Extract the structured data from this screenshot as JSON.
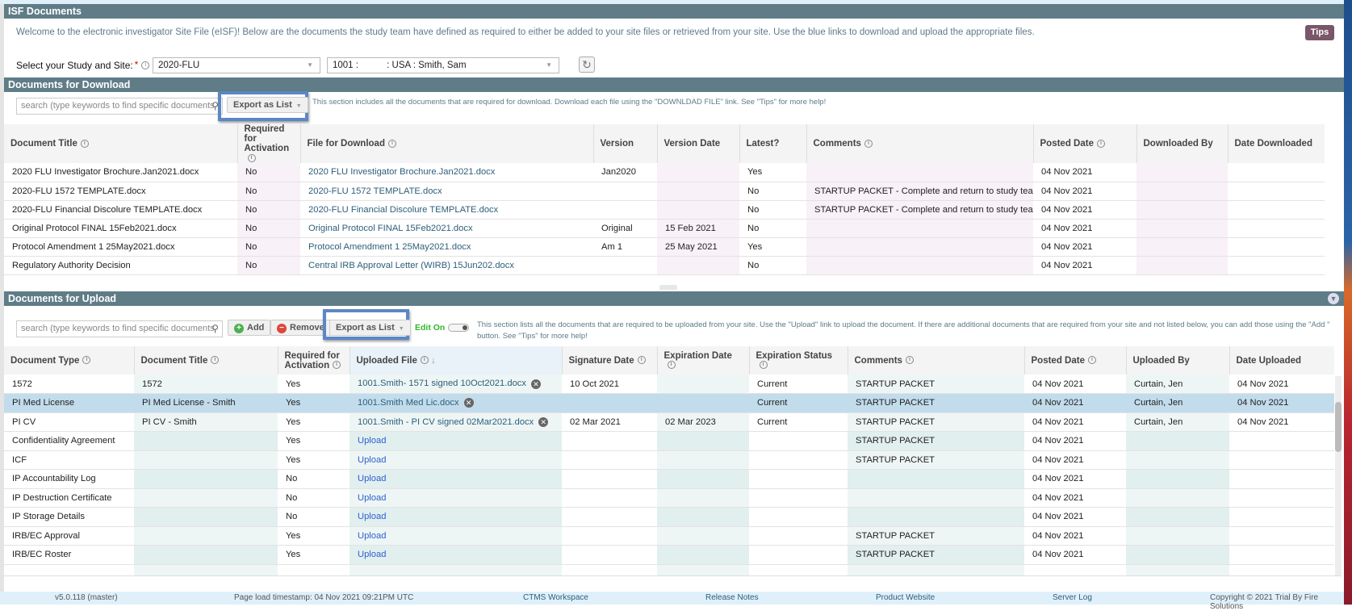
{
  "isf": {
    "title": "ISF Documents",
    "welcome": "Welcome to the electronic investigator Site File (eISF)! Below are the documents the study team have defined as required to either be added to your site files or retrieved from your site. Use the blue links to download and upload the appropriate files.",
    "tips_label": "Tips",
    "select_label": "Select your Study and Site:",
    "required_mark": "*",
    "study_value": "2020-FLU",
    "site_value": "1001 :           : USA : Smith, Sam"
  },
  "download": {
    "title": "Documents for Download",
    "search_placeholder": "search (type keywords to find specific documents",
    "export_label": "Export as List",
    "note": "This section includes all the documents that are required for download. Download each file using the \"DOWNLDAD FILE\" link. See \"Tips\" for more help!",
    "columns": [
      "Document Title",
      "Required for Activation",
      "File for Download",
      "Version",
      "Version Date",
      "Latest?",
      "Comments",
      "Posted Date",
      "Downloaded By",
      "Date Downloaded"
    ],
    "rows": [
      [
        "2020 FLU Investigator Brochure.Jan2021.docx",
        "No",
        "2020 FLU Investigator Brochure.Jan2021.docx",
        "Jan2020",
        "",
        "Yes",
        "",
        "04 Nov 2021",
        "",
        ""
      ],
      [
        "2020-FLU 1572 TEMPLATE.docx",
        "No",
        "2020-FLU 1572 TEMPLATE.docx",
        "",
        "",
        "No",
        "STARTUP PACKET - Complete and return to study team",
        "04 Nov 2021",
        "",
        ""
      ],
      [
        "2020-FLU Financial Discolure TEMPLATE.docx",
        "No",
        "2020-FLU Financial Discolure TEMPLATE.docx",
        "",
        "",
        "No",
        "STARTUP PACKET - Complete and return to study team",
        "04 Nov 2021",
        "",
        ""
      ],
      [
        "Original Protocol FINAL 15Feb2021.docx",
        "No",
        "Original Protocol FINAL 15Feb2021.docx",
        "Original",
        "15 Feb 2021",
        "No",
        "",
        "04 Nov 2021",
        "",
        ""
      ],
      [
        "Protocol Amendment 1 25May2021.docx",
        "No",
        "Protocol Amendment 1 25May2021.docx",
        "Am 1",
        "25 May 2021",
        "Yes",
        "",
        "04 Nov 2021",
        "",
        ""
      ],
      [
        "Regulatory Authority Decision",
        "No",
        "Central IRB Approval Letter (WIRB) 15Jun202.docx",
        "",
        "",
        "No",
        "",
        "04 Nov 2021",
        "",
        ""
      ]
    ]
  },
  "upload": {
    "title": "Documents for Upload",
    "search_placeholder": "search (type keywords to find specific documents",
    "add_label": "Add",
    "remove_label": "Remove",
    "export_label": "Export as List",
    "edit_label": "Edit On",
    "note": "This section lists all the documents that are required to be uploaded from your site. Use the \"Upload\" link to upload the document. If there are additional documents that are required from your site and not listed below, you can add those using the \"Add \" button. See \"Tips\" for more help!",
    "columns": [
      "Document Type",
      "Document Title",
      "Required for Activation",
      "Uploaded File",
      "Signature Date",
      "Expiration Date",
      "Expiration Status",
      "Comments",
      "Posted Date",
      "Uploaded By",
      "Date Uploaded"
    ],
    "rows": [
      [
        "1572",
        "1572",
        "Yes",
        "1001.Smith- 1571 signed 10Oct2021.docx",
        "10 Oct 2021",
        "",
        "Current",
        "STARTUP PACKET",
        "04 Nov 2021",
        "Curtain, Jen",
        "04 Nov 2021"
      ],
      [
        "PI Med License",
        "PI Med License - Smith",
        "Yes",
        "1001.Smith Med Lic.docx",
        "",
        "",
        "Current",
        "STARTUP PACKET",
        "04 Nov 2021",
        "Curtain, Jen",
        "04 Nov 2021"
      ],
      [
        "PI CV",
        "PI CV - Smith",
        "Yes",
        "1001.Smith - PI CV signed 02Mar2021.docx",
        "02 Mar 2021",
        "02 Mar 2023",
        "Current",
        "STARTUP PACKET",
        "04 Nov 2021",
        "Curtain, Jen",
        "04 Nov 2021"
      ],
      [
        "Confidentiality Agreement",
        "",
        "Yes",
        "Upload",
        "",
        "",
        "",
        "STARTUP PACKET",
        "04 Nov 2021",
        "",
        ""
      ],
      [
        "ICF",
        "",
        "Yes",
        "Upload",
        "",
        "",
        "",
        "STARTUP PACKET",
        "04 Nov 2021",
        "",
        ""
      ],
      [
        "IP Accountability Log",
        "",
        "No",
        "Upload",
        "",
        "",
        "",
        "",
        "04 Nov 2021",
        "",
        ""
      ],
      [
        "IP Destruction Certificate",
        "",
        "No",
        "Upload",
        "",
        "",
        "",
        "",
        "04 Nov 2021",
        "",
        ""
      ],
      [
        "IP Storage Details",
        "",
        "No",
        "Upload",
        "",
        "",
        "",
        "",
        "04 Nov 2021",
        "",
        ""
      ],
      [
        "IRB/EC Approval",
        "",
        "Yes",
        "Upload",
        "",
        "",
        "",
        "STARTUP PACKET",
        "04 Nov 2021",
        "",
        ""
      ],
      [
        "IRB/EC Roster",
        "",
        "Yes",
        "Upload",
        "",
        "",
        "",
        "STARTUP PACKET",
        "04 Nov 2021",
        "",
        ""
      ],
      [
        "",
        "",
        "",
        "",
        "",
        "",
        "",
        "",
        "",
        "",
        ""
      ]
    ],
    "selected_row": 1
  },
  "footer": {
    "version": "v5.0.118 (master)",
    "timestamp": "Page load timestamp: 04 Nov 2021 09:21PM UTC",
    "ctms": "CTMS Workspace",
    "release": "Release Notes",
    "product": "Product Website",
    "server": "Server Log",
    "copyright": "Copyright © 2021 Trial By Fire Solutions"
  },
  "colors": {
    "header_bar": "#5f7c87",
    "tips": "#7a5668",
    "link": "#2d5e7a",
    "upload_link": "#2f5fd0",
    "highlight": "#5b87c5",
    "selected_row": "#c2dcec",
    "edit_on": "#2eb82e"
  }
}
